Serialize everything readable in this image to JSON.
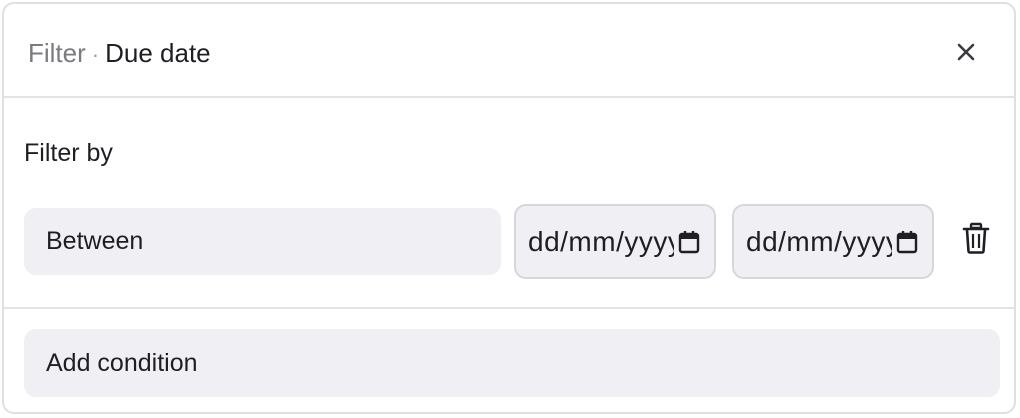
{
  "header": {
    "crumb": "Filter",
    "separator": "·",
    "title": "Due date",
    "close_icon": "close-icon"
  },
  "filter": {
    "label": "Filter by",
    "operator": "Between",
    "date_from_placeholder": "dd/mm/yyyy",
    "date_to_placeholder": "dd/mm/yyyy",
    "calendar_icon": "calendar-icon",
    "delete_icon": "trash-icon"
  },
  "footer": {
    "add_condition_label": "Add condition"
  },
  "colors": {
    "field_bg": "#f0f0f4",
    "border": "#e4e4e7",
    "text": "#1f1f23",
    "muted_text": "#7a7a80"
  }
}
